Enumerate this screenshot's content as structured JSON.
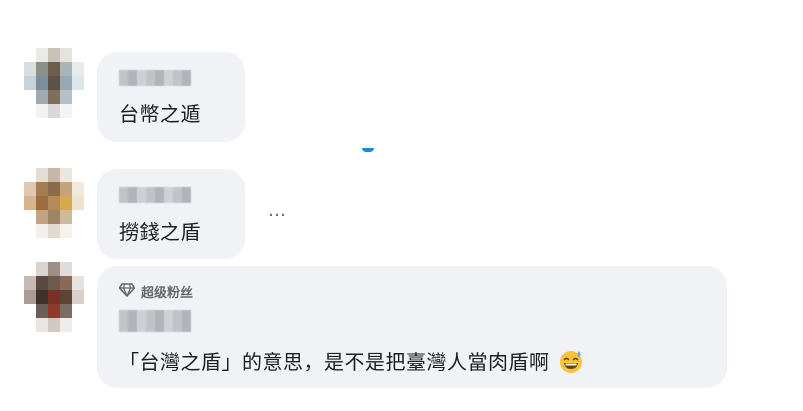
{
  "comments": [
    {
      "message": "台幣之遁"
    },
    {
      "message": "撈錢之盾"
    },
    {
      "badge": "超级粉丝",
      "message": "「台灣之盾」的意思，是不是把臺灣人當肉盾啊"
    }
  ],
  "more_options": "…",
  "emoji": "grinning-sweat-emoji"
}
